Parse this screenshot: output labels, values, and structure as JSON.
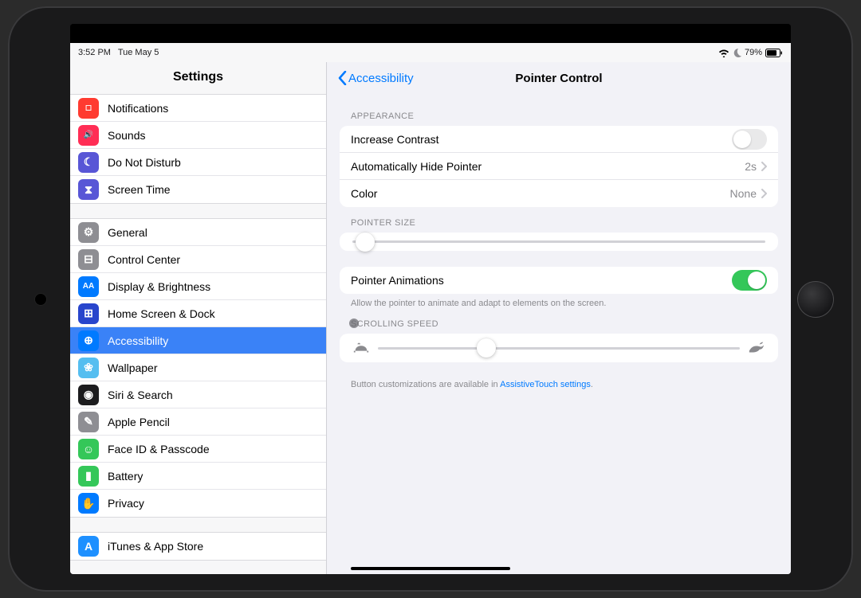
{
  "status": {
    "time": "3:52 PM",
    "date": "Tue May 5",
    "battery": "79%"
  },
  "sidebar": {
    "title": "Settings",
    "groups": [
      [
        {
          "id": "notifications",
          "label": "Notifications",
          "iconColor": "#ff3b30",
          "glyph": "◻︎"
        },
        {
          "id": "sounds",
          "label": "Sounds",
          "iconColor": "#ff2d55",
          "glyph": "🔊"
        },
        {
          "id": "dnd",
          "label": "Do Not Disturb",
          "iconColor": "#5856d6",
          "glyph": "☾"
        },
        {
          "id": "screentime",
          "label": "Screen Time",
          "iconColor": "#5856d6",
          "glyph": "⧗"
        }
      ],
      [
        {
          "id": "general",
          "label": "General",
          "iconColor": "#8e8e93",
          "glyph": "⚙"
        },
        {
          "id": "control-center",
          "label": "Control Center",
          "iconColor": "#8e8e93",
          "glyph": "⊟"
        },
        {
          "id": "display",
          "label": "Display & Brightness",
          "iconColor": "#007aff",
          "glyph": "AA"
        },
        {
          "id": "home-dock",
          "label": "Home Screen & Dock",
          "iconColor": "#2845cc",
          "glyph": "⊞"
        },
        {
          "id": "accessibility",
          "label": "Accessibility",
          "iconColor": "#007aff",
          "glyph": "⊕",
          "active": true
        },
        {
          "id": "wallpaper",
          "label": "Wallpaper",
          "iconColor": "#55bef0",
          "glyph": "❀"
        },
        {
          "id": "siri",
          "label": "Siri & Search",
          "iconColor": "#1c1c1e",
          "glyph": "◉"
        },
        {
          "id": "pencil",
          "label": "Apple Pencil",
          "iconColor": "#8e8e93",
          "glyph": "✎"
        },
        {
          "id": "faceid",
          "label": "Face ID & Passcode",
          "iconColor": "#34c759",
          "glyph": "☺"
        },
        {
          "id": "battery",
          "label": "Battery",
          "iconColor": "#34c759",
          "glyph": "▮"
        },
        {
          "id": "privacy",
          "label": "Privacy",
          "iconColor": "#007aff",
          "glyph": "✋"
        }
      ],
      [
        {
          "id": "itunes",
          "label": "iTunes & App Store",
          "iconColor": "#1e90ff",
          "glyph": "A"
        }
      ]
    ]
  },
  "detail": {
    "back": "Accessibility",
    "title": "Pointer Control",
    "sections": {
      "appearance": {
        "header": "APPEARANCE",
        "rows": {
          "contrast": {
            "label": "Increase Contrast",
            "toggle": false
          },
          "autohide": {
            "label": "Automatically Hide Pointer",
            "value": "2s"
          },
          "color": {
            "label": "Color",
            "value": "None"
          }
        }
      },
      "size": {
        "header": "POINTER SIZE",
        "sliderPercent": 3
      },
      "animations": {
        "label": "Pointer Animations",
        "toggle": true,
        "foot": "Allow the pointer to animate and adapt to elements on the screen."
      },
      "scroll": {
        "header": "SCROLLING SPEED",
        "sliderPercent": 30
      },
      "footer": {
        "text": "Button customizations are available in ",
        "link": "AssistiveTouch settings",
        "tail": "."
      }
    }
  }
}
